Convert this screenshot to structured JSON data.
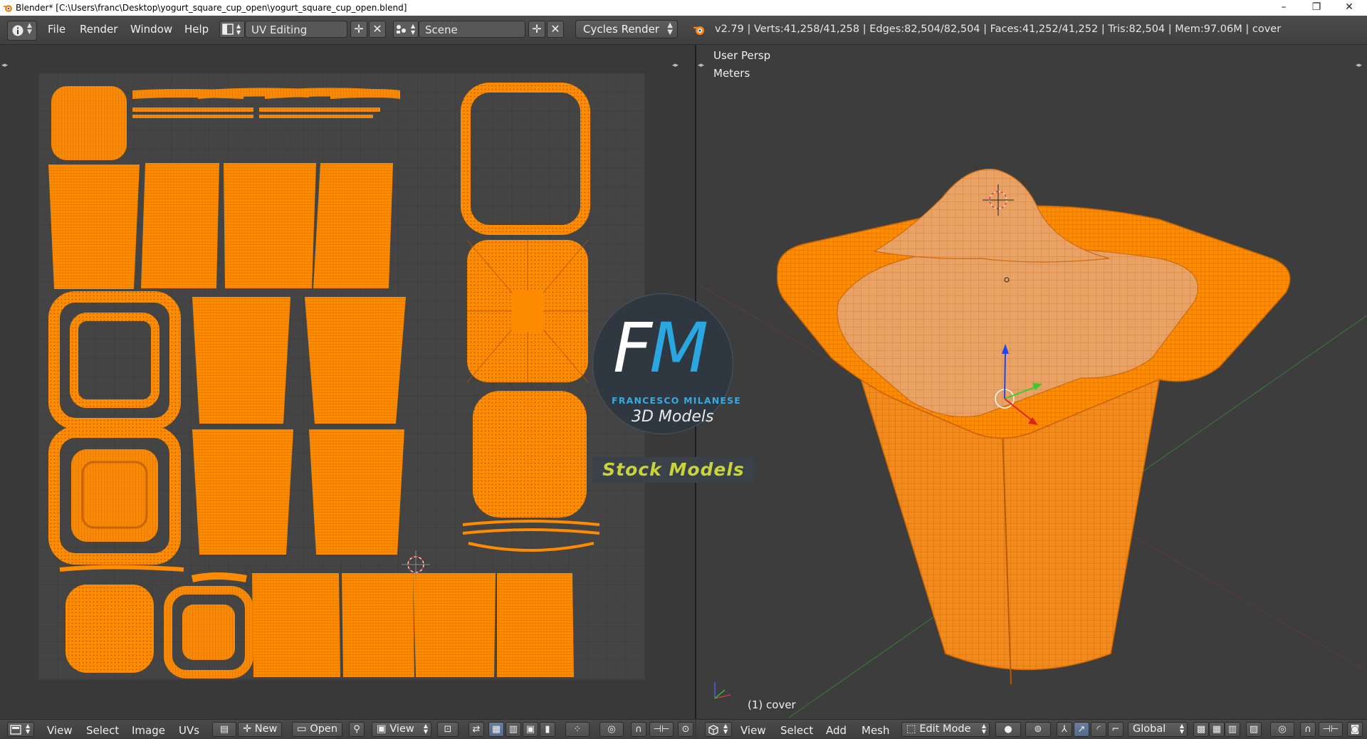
{
  "window": {
    "title": "Blender* [C:\\Users\\franc\\Desktop\\yogurt_square_cup_open\\yogurt_square_cup_open.blend]",
    "minimize": "–",
    "maximize": "❐",
    "close": "✕"
  },
  "info_header": {
    "editor_icon": "info-icon",
    "menus": [
      "File",
      "Render",
      "Window",
      "Help"
    ],
    "screen_layout": "UV Editing",
    "scene": "Scene",
    "render_engine": "Cycles Render",
    "stats": "v2.79 | Verts:41,258/41,258 | Edges:82,504/82,504 | Faces:41,252/41,252 | Tris:82,504 | Mem:97.06M | cover"
  },
  "viewport": {
    "view_name": "User Persp",
    "units": "Meters",
    "object_label": "(1) cover"
  },
  "uv_header": {
    "menus": [
      "View",
      "Select",
      "Image",
      "UVs"
    ],
    "new_label": "New",
    "open_label": "Open",
    "view_label": "View"
  },
  "view3d_header": {
    "menus": [
      "View",
      "Select",
      "Add",
      "Mesh"
    ],
    "mode": "Edit Mode",
    "orientation": "Global"
  },
  "watermark": {
    "initial_f": "F",
    "initial_m": "M",
    "name": "FRANCESCO MILANESE",
    "subtitle": "3D Models",
    "banner": "Stock Models"
  },
  "colors": {
    "mesh": "#ff8c00",
    "mesh_wire": "#d96f00",
    "background": "#393939",
    "logo_blue": "#2aa6e0",
    "banner_text": "#c8d43a"
  }
}
